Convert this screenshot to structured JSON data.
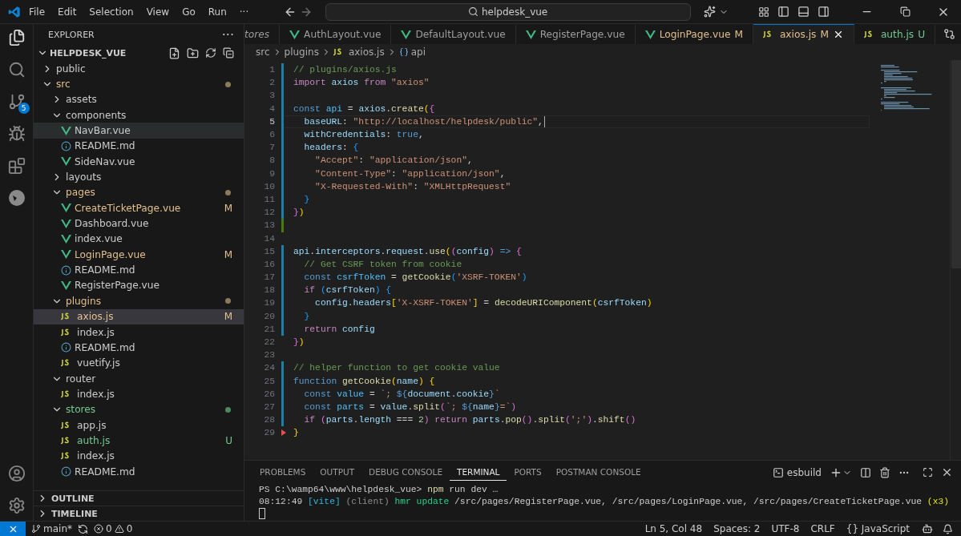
{
  "title_bar": {
    "menu": [
      "File",
      "Edit",
      "Selection",
      "View",
      "Go",
      "Run",
      "···"
    ],
    "search": {
      "value": "helpdesk_vue"
    }
  },
  "activity_bar": {
    "source_control_badge": "5"
  },
  "sidebar": {
    "title": "EXPLORER",
    "more": "···",
    "root": {
      "label": "HELPDESK_VUE",
      "expanded": true
    },
    "tree": [
      {
        "name": "public",
        "kind": "folder",
        "expanded": false,
        "modified": false,
        "untracked": false,
        "selected": false
      },
      {
        "name": "src",
        "kind": "folder",
        "expanded": true,
        "modified": true,
        "untracked": false,
        "selected": false,
        "children": [
          {
            "name": "assets",
            "kind": "folder",
            "expanded": false,
            "modified": false,
            "untracked": false,
            "selected": false
          },
          {
            "name": "components",
            "kind": "folder",
            "expanded": true,
            "modified": false,
            "untracked": false,
            "selected": false,
            "children": [
              {
                "name": "NavBar.vue",
                "kind": "vue",
                "modified": false,
                "untracked": false,
                "selected": false,
                "hovered": true
              },
              {
                "name": "README.md",
                "kind": "md",
                "modified": false,
                "untracked": false,
                "selected": false
              },
              {
                "name": "SideNav.vue",
                "kind": "vue",
                "modified": false,
                "untracked": false,
                "selected": false
              }
            ]
          },
          {
            "name": "layouts",
            "kind": "folder",
            "expanded": false,
            "modified": false,
            "untracked": false,
            "selected": false
          },
          {
            "name": "pages",
            "kind": "folder",
            "expanded": true,
            "modified": true,
            "untracked": false,
            "selected": false,
            "children": [
              {
                "name": "CreateTicketPage.vue",
                "kind": "vue",
                "modified": true,
                "untracked": false,
                "badge": "M",
                "selected": false
              },
              {
                "name": "Dashboard.vue",
                "kind": "vue",
                "modified": false,
                "untracked": false,
                "selected": false
              },
              {
                "name": "index.vue",
                "kind": "vue",
                "modified": false,
                "untracked": false,
                "selected": false
              },
              {
                "name": "LoginPage.vue",
                "kind": "vue",
                "modified": true,
                "untracked": false,
                "badge": "M",
                "selected": false
              },
              {
                "name": "README.md",
                "kind": "md",
                "modified": false,
                "untracked": false,
                "selected": false
              },
              {
                "name": "RegisterPage.vue",
                "kind": "vue",
                "modified": false,
                "untracked": false,
                "selected": false
              }
            ]
          },
          {
            "name": "plugins",
            "kind": "folder",
            "expanded": true,
            "modified": true,
            "untracked": false,
            "selected": false,
            "children": [
              {
                "name": "axios.js",
                "kind": "js",
                "modified": true,
                "untracked": false,
                "badge": "M",
                "selected": true
              },
              {
                "name": "index.js",
                "kind": "js",
                "modified": false,
                "untracked": false,
                "selected": false
              },
              {
                "name": "README.md",
                "kind": "md",
                "modified": false,
                "untracked": false,
                "selected": false
              },
              {
                "name": "vuetify.js",
                "kind": "js",
                "modified": false,
                "untracked": false,
                "selected": false
              }
            ]
          },
          {
            "name": "router",
            "kind": "folder",
            "expanded": true,
            "modified": false,
            "untracked": false,
            "selected": false,
            "children": [
              {
                "name": "index.js",
                "kind": "js",
                "modified": false,
                "untracked": false,
                "selected": false
              }
            ]
          },
          {
            "name": "stores",
            "kind": "folder",
            "expanded": true,
            "modified": false,
            "untracked": true,
            "selected": false,
            "children": [
              {
                "name": "app.js",
                "kind": "js",
                "modified": false,
                "untracked": false,
                "selected": false
              },
              {
                "name": "auth.js",
                "kind": "js",
                "modified": false,
                "untracked": true,
                "badge": "U",
                "selected": false
              },
              {
                "name": "index.js",
                "kind": "js",
                "modified": false,
                "untracked": false,
                "selected": false
              },
              {
                "name": "README.md",
                "kind": "md",
                "modified": false,
                "untracked": false,
                "selected": false
              }
            ]
          }
        ]
      }
    ],
    "sections": [
      {
        "label": "OUTLINE",
        "expanded": false
      },
      {
        "label": "TIMELINE",
        "expanded": false
      }
    ]
  },
  "tabs": [
    {
      "label": "tores",
      "kind": "preview",
      "modified": false,
      "untracked": false,
      "selected": false
    },
    {
      "label": "AuthLayout.vue",
      "kind": "vue",
      "modified": false,
      "untracked": false,
      "selected": false
    },
    {
      "label": "DefaultLayout.vue",
      "kind": "vue",
      "modified": false,
      "untracked": false,
      "selected": false
    },
    {
      "label": "RegisterPage.vue",
      "kind": "vue",
      "modified": false,
      "untracked": false,
      "selected": false
    },
    {
      "label": "LoginPage.vue",
      "kind": "vue",
      "modified": true,
      "untracked": false,
      "badge": "M",
      "selected": false
    },
    {
      "label": "axios.js",
      "kind": "js",
      "modified": true,
      "untracked": false,
      "badge": "M",
      "selected": true
    },
    {
      "label": "auth.js",
      "kind": "js",
      "modified": false,
      "untracked": true,
      "badge": "U",
      "selected": false
    }
  ],
  "breadcrumb": [
    "src",
    "plugins",
    "axios.js",
    "api"
  ],
  "code": [
    {
      "number": "1",
      "kind": "modified",
      "current": false,
      "tokens": [
        {
          "kind": "comment",
          "text": "// plugins/axios.js"
        }
      ]
    },
    {
      "number": "2",
      "kind": "modified",
      "current": false,
      "tokens": [
        {
          "kind": "keyword",
          "text": "import"
        },
        {
          "kind": "variable",
          "text": " axios"
        },
        {
          "kind": "keyword",
          "text": " from"
        },
        {
          "kind": "string",
          "text": " \"axios\""
        }
      ]
    },
    {
      "number": "3",
      "kind": "modified",
      "current": false
    },
    {
      "number": "4",
      "kind": "modified",
      "current": false,
      "tokens": [
        {
          "kind": "storage",
          "text": "const"
        },
        {
          "kind": "constant",
          "text": " api"
        },
        {
          "kind": "plain",
          "text": " = "
        },
        {
          "kind": "variable",
          "text": "axios"
        },
        {
          "kind": "plain",
          "text": "."
        },
        {
          "kind": "function",
          "text": "create"
        },
        {
          "kind": "bracket1",
          "text": "("
        },
        {
          "kind": "bracket2",
          "text": "{"
        }
      ]
    },
    {
      "number": "5",
      "kind": "modified",
      "current": true,
      "tokens": [
        {
          "kind": "variable",
          "text": "  baseURL"
        },
        {
          "kind": "plain",
          "text": ": "
        },
        {
          "kind": "string",
          "text": "\"http://localhost/helpdesk/public\""
        },
        {
          "kind": "plain",
          "text": ","
        }
      ]
    },
    {
      "number": "6",
      "kind": "modified",
      "current": false,
      "tokens": [
        {
          "kind": "variable",
          "text": "  withCredentials"
        },
        {
          "kind": "plain",
          "text": ": "
        },
        {
          "kind": "storage",
          "text": "true"
        },
        {
          "kind": "plain",
          "text": ","
        }
      ]
    },
    {
      "number": "7",
      "kind": "modified",
      "current": false,
      "tokens": [
        {
          "kind": "variable",
          "text": "  headers"
        },
        {
          "kind": "plain",
          "text": ": "
        },
        {
          "kind": "bracket3",
          "text": "{"
        }
      ]
    },
    {
      "number": "8",
      "kind": "modified",
      "current": false,
      "tokens": [
        {
          "kind": "string",
          "text": "    \"Accept\""
        },
        {
          "kind": "plain",
          "text": ": "
        },
        {
          "kind": "string",
          "text": "\"application/json\""
        },
        {
          "kind": "plain",
          "text": ","
        }
      ]
    },
    {
      "number": "9",
      "kind": "modified",
      "current": false,
      "tokens": [
        {
          "kind": "string",
          "text": "    \"Content-Type\""
        },
        {
          "kind": "plain",
          "text": ": "
        },
        {
          "kind": "string",
          "text": "\"application/json\""
        },
        {
          "kind": "plain",
          "text": ","
        }
      ]
    },
    {
      "number": "10",
      "kind": "modified",
      "current": false,
      "tokens": [
        {
          "kind": "string",
          "text": "    \"X-Requested-With\""
        },
        {
          "kind": "plain",
          "text": ": "
        },
        {
          "kind": "string",
          "text": "\"XMLHttpRequest\""
        }
      ]
    },
    {
      "number": "11",
      "kind": "modified",
      "current": false,
      "tokens": [
        {
          "kind": "bracket3",
          "text": "  }"
        }
      ]
    },
    {
      "number": "12",
      "kind": "modified",
      "current": false,
      "tokens": [
        {
          "kind": "bracket2",
          "text": "}"
        },
        {
          "kind": "bracket1",
          "text": ")"
        }
      ]
    },
    {
      "number": "13",
      "kind": "added",
      "current": false
    },
    {
      "number": "14",
      "kind": "plain",
      "current": false
    },
    {
      "number": "15",
      "kind": "modified",
      "current": false,
      "tokens": [
        {
          "kind": "variable",
          "text": "api"
        },
        {
          "kind": "plain",
          "text": "."
        },
        {
          "kind": "variable",
          "text": "interceptors"
        },
        {
          "kind": "plain",
          "text": "."
        },
        {
          "kind": "variable",
          "text": "request"
        },
        {
          "kind": "plain",
          "text": "."
        },
        {
          "kind": "function",
          "text": "use"
        },
        {
          "kind": "bracket1",
          "text": "("
        },
        {
          "kind": "bracket2",
          "text": "("
        },
        {
          "kind": "variable",
          "text": "config"
        },
        {
          "kind": "bracket2",
          "text": ")"
        },
        {
          "kind": "storage",
          "text": " =>"
        },
        {
          "kind": "bracket2",
          "text": " {"
        }
      ]
    },
    {
      "number": "16",
      "kind": "modified",
      "current": false,
      "tokens": [
        {
          "kind": "comment",
          "text": "  // Get CSRF token from cookie"
        }
      ]
    },
    {
      "number": "17",
      "kind": "modified",
      "current": false,
      "tokens": [
        {
          "kind": "storage",
          "text": "  const"
        },
        {
          "kind": "constant",
          "text": " csrfToken"
        },
        {
          "kind": "plain",
          "text": " = "
        },
        {
          "kind": "function",
          "text": "getCookie"
        },
        {
          "kind": "bracket3",
          "text": "("
        },
        {
          "kind": "string",
          "text": "'XSRF-TOKEN'"
        },
        {
          "kind": "bracket3",
          "text": ")"
        }
      ]
    },
    {
      "number": "18",
      "kind": "modified",
      "current": false,
      "tokens": [
        {
          "kind": "keyword",
          "text": "  if"
        },
        {
          "kind": "bracket3",
          "text": " ("
        },
        {
          "kind": "variable",
          "text": "csrfToken"
        },
        {
          "kind": "bracket3",
          "text": ")"
        },
        {
          "kind": "bracket3",
          "text": " {"
        }
      ]
    },
    {
      "number": "19",
      "kind": "modified",
      "current": false,
      "tokens": [
        {
          "kind": "variable",
          "text": "    config"
        },
        {
          "kind": "plain",
          "text": "."
        },
        {
          "kind": "variable",
          "text": "headers"
        },
        {
          "kind": "bracket1",
          "text": "["
        },
        {
          "kind": "string",
          "text": "'X-XSRF-TOKEN'"
        },
        {
          "kind": "bracket1",
          "text": "]"
        },
        {
          "kind": "plain",
          "text": " = "
        },
        {
          "kind": "function",
          "text": "decodeURIComponent"
        },
        {
          "kind": "bracket1",
          "text": "("
        },
        {
          "kind": "variable",
          "text": "csrfToken"
        },
        {
          "kind": "bracket1",
          "text": ")"
        }
      ]
    },
    {
      "number": "20",
      "kind": "modified",
      "current": false,
      "tokens": [
        {
          "kind": "bracket3",
          "text": "  }"
        }
      ]
    },
    {
      "number": "21",
      "kind": "modified",
      "current": false,
      "tokens": [
        {
          "kind": "keyword",
          "text": "  return"
        },
        {
          "kind": "variable",
          "text": " config"
        }
      ]
    },
    {
      "number": "22",
      "kind": "plain",
      "current": false,
      "tokens": [
        {
          "kind": "bracket2",
          "text": "}"
        },
        {
          "kind": "bracket1",
          "text": ")"
        }
      ]
    },
    {
      "number": "23",
      "kind": "plain",
      "current": false
    },
    {
      "number": "24",
      "kind": "modified",
      "current": false,
      "tokens": [
        {
          "kind": "comment",
          "text": "// helper function to get cookie value"
        }
      ]
    },
    {
      "number": "25",
      "kind": "modified",
      "current": false,
      "tokens": [
        {
          "kind": "storage",
          "text": "function"
        },
        {
          "kind": "function",
          "text": " getCookie"
        },
        {
          "kind": "bracket1",
          "text": "("
        },
        {
          "kind": "variable",
          "text": "name"
        },
        {
          "kind": "bracket1",
          "text": ")"
        },
        {
          "kind": "bracket1",
          "text": " {"
        }
      ]
    },
    {
      "number": "26",
      "kind": "modified",
      "current": false,
      "tokens": [
        {
          "kind": "storage",
          "text": "  const"
        },
        {
          "kind": "constant",
          "text": " value"
        },
        {
          "kind": "plain",
          "text": " = "
        },
        {
          "kind": "string",
          "text": "`; "
        },
        {
          "kind": "storage",
          "text": "${"
        },
        {
          "kind": "variable",
          "text": "document"
        },
        {
          "kind": "plain",
          "text": "."
        },
        {
          "kind": "variable",
          "text": "cookie"
        },
        {
          "kind": "storage",
          "text": "}"
        },
        {
          "kind": "string",
          "text": "`"
        }
      ]
    },
    {
      "number": "27",
      "kind": "modified",
      "current": false,
      "tokens": [
        {
          "kind": "storage",
          "text": "  const"
        },
        {
          "kind": "constant",
          "text": " parts"
        },
        {
          "kind": "plain",
          "text": " = "
        },
        {
          "kind": "variable",
          "text": "value"
        },
        {
          "kind": "plain",
          "text": "."
        },
        {
          "kind": "function",
          "text": "split"
        },
        {
          "kind": "bracket2",
          "text": "("
        },
        {
          "kind": "string",
          "text": "`; "
        },
        {
          "kind": "storage",
          "text": "${"
        },
        {
          "kind": "variable",
          "text": "name"
        },
        {
          "kind": "storage",
          "text": "}"
        },
        {
          "kind": "string",
          "text": "=`"
        },
        {
          "kind": "bracket2",
          "text": ")"
        }
      ]
    },
    {
      "number": "28",
      "kind": "modified",
      "current": false,
      "tokens": [
        {
          "kind": "keyword",
          "text": "  if"
        },
        {
          "kind": "bracket2",
          "text": " ("
        },
        {
          "kind": "variable",
          "text": "parts"
        },
        {
          "kind": "plain",
          "text": "."
        },
        {
          "kind": "variable",
          "text": "length"
        },
        {
          "kind": "plain",
          "text": " === "
        },
        {
          "kind": "number",
          "text": "2"
        },
        {
          "kind": "bracket2",
          "text": ")"
        },
        {
          "kind": "keyword",
          "text": " return"
        },
        {
          "kind": "variable",
          "text": " parts"
        },
        {
          "kind": "plain",
          "text": "."
        },
        {
          "kind": "function",
          "text": "pop"
        },
        {
          "kind": "bracket2",
          "text": "()"
        },
        {
          "kind": "plain",
          "text": "."
        },
        {
          "kind": "function",
          "text": "split"
        },
        {
          "kind": "bracket2",
          "text": "("
        },
        {
          "kind": "string",
          "text": "';'"
        },
        {
          "kind": "bracket2",
          "text": ")"
        },
        {
          "kind": "plain",
          "text": "."
        },
        {
          "kind": "function",
          "text": "shift"
        },
        {
          "kind": "bracket2",
          "text": "()"
        }
      ]
    },
    {
      "number": "29",
      "kind": "deleted",
      "current": false,
      "tokens": [
        {
          "kind": "bracket1",
          "text": "}"
        }
      ]
    }
  ],
  "panel": {
    "tabs": [
      {
        "label": "PROBLEMS",
        "selected": false
      },
      {
        "label": "OUTPUT",
        "selected": false
      },
      {
        "label": "DEBUG CONSOLE",
        "selected": false
      },
      {
        "label": "TERMINAL",
        "selected": true
      },
      {
        "label": "PORTS",
        "selected": false
      },
      {
        "label": "POSTMAN CONSOLE",
        "selected": false
      }
    ],
    "terminal_name": "esbuild",
    "lines": [
      [
        {
          "kind": "plain",
          "text": "PS C:\\wamp64\\www\\helpdesk_vue>"
        },
        {
          "kind": "function",
          "text": " npm"
        },
        {
          "kind": "plain",
          "text": " run dev …"
        }
      ],
      [
        {
          "kind": "plain",
          "text": "08:12:49"
        },
        {
          "kind": "cyan",
          "text": " [vite]"
        },
        {
          "kind": "dim",
          "text": " (client)"
        },
        {
          "kind": "green",
          "text": " hmr update"
        },
        {
          "kind": "plain",
          "text": " /src/pages/RegisterPage.vue, /src/pages/LoginPage.vue, /src/pages/CreateTicketPage.vue"
        },
        {
          "kind": "yellow",
          "text": " (x3)"
        }
      ]
    ]
  },
  "status_bar": {
    "branch": "main*",
    "errors": "0",
    "warnings": "0",
    "items": [
      "Ln 5, Col 48",
      "Spaces: 2",
      "UTF-8",
      "CRLF",
      "{} JavaScript"
    ]
  }
}
